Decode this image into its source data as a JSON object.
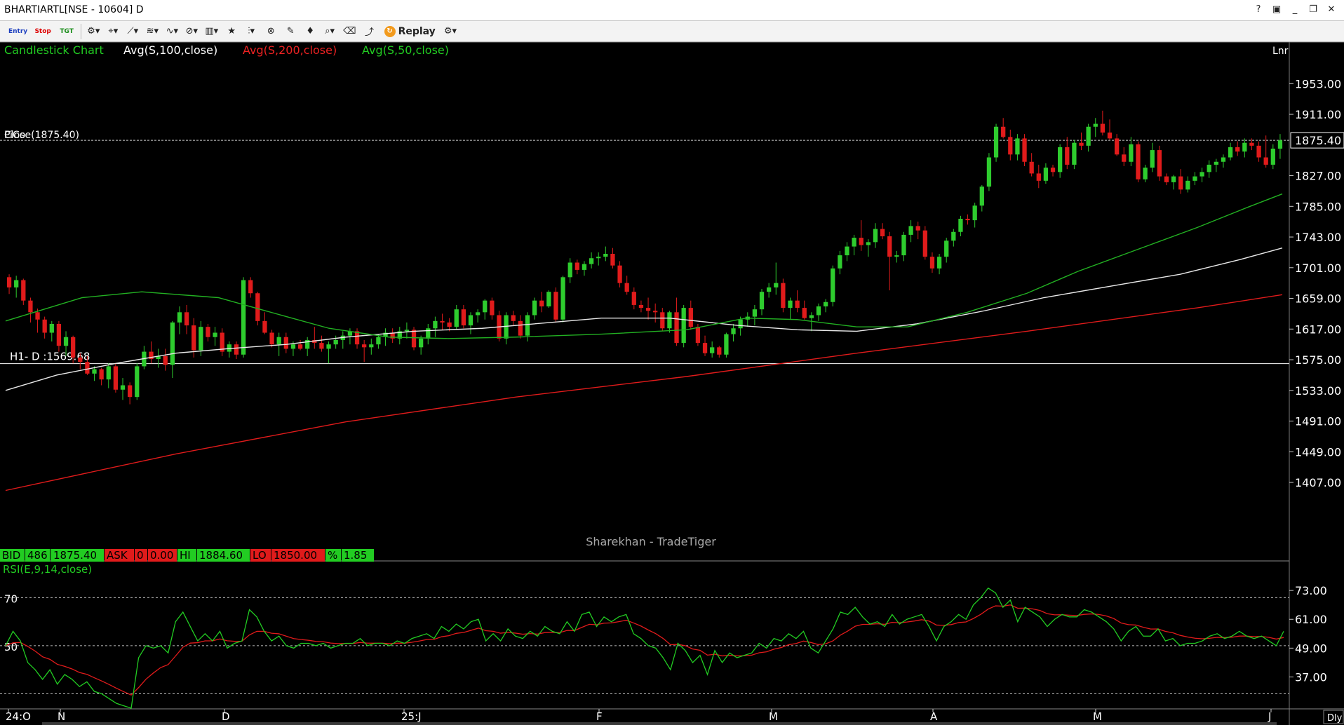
{
  "window": {
    "title": "BHARTIARTL[NSE - 10604] D",
    "buttons": [
      "help-icon",
      "monitor-icon",
      "minimize-icon",
      "restore-icon",
      "close-icon"
    ]
  },
  "toolbar": {
    "entry_label": "Entry",
    "stop_label": "Stop",
    "tgt_label": "TGT",
    "replay_label": "Replay",
    "icons": [
      "settings-wheel-icon",
      "pointer-icon",
      "line-tools-icon",
      "fib-icon",
      "wave-icon",
      "channel-icon",
      "bar-style-icon",
      "star-icon",
      "indicator-icon",
      "pattern-icon",
      "cursor-icon",
      "alert-icon",
      "zoom-icon",
      "delete-icon",
      "study-icon"
    ]
  },
  "colors": {
    "background": "#000000",
    "up": "#2ecc2e",
    "down": "#e01b1b",
    "sma100": "#e8e8e8",
    "sma200": "#e01b1b",
    "sma50": "#22b022",
    "rsi": "#22cc22",
    "rsi_signal": "#e01b1b",
    "axis_text": "#ffffff"
  },
  "legend": {
    "chart_type": "Candlestick Chart",
    "sma100": "Avg(S,100,close)",
    "sma200": "Avg(S,200,close)",
    "sma50": "Avg(S,50,close)",
    "corner": "Lnr"
  },
  "price_axis": {
    "labels": [
      "1953.00",
      "1911.00",
      "1827.00",
      "1785.00",
      "1743.00",
      "1701.00",
      "1659.00",
      "1617.00",
      "1575.00",
      "1533.00",
      "1491.00",
      "1449.00",
      "1407.00"
    ],
    "current_price_label": "1875.40"
  },
  "annotations": {
    "close_line_text": "Close(1875.40)",
    "overlap_text": "PiCo",
    "hline_text": "H1- D :1569.68",
    "watermark": "Sharekhan - TradeTiger"
  },
  "quote_bar": {
    "bid_label": "BID",
    "bid_qty": "486",
    "bid_price": "1875.40",
    "ask_label": "ASK",
    "ask_qty": "0",
    "ask_price": "0.00",
    "hi_label": "HI",
    "hi_value": "1884.60",
    "lo_label": "LO",
    "lo_value": "1850.00",
    "pct_label": "%",
    "pct_value": "1.85"
  },
  "rsi_panel": {
    "label": "RSI(E,9,14,close)",
    "left_levels": [
      "70",
      "50"
    ],
    "axis_labels": [
      "73.00",
      "61.00",
      "49.00",
      "37.00"
    ]
  },
  "time_axis": {
    "labels": [
      "24:O",
      "N",
      "D",
      "25:J",
      "F",
      "M",
      "A",
      "M",
      "J"
    ],
    "corner": "Dly"
  },
  "chart_data": {
    "type": "candlestick",
    "ylim": [
      1380,
      1975
    ],
    "current_close": 1875.4,
    "horizontal_line": 1569.68,
    "candles": [
      [
        1688,
        1692,
        1665,
        1674
      ],
      [
        1674,
        1690,
        1660,
        1684
      ],
      [
        1684,
        1686,
        1650,
        1656
      ],
      [
        1656,
        1660,
        1626,
        1640
      ],
      [
        1640,
        1645,
        1612,
        1630
      ],
      [
        1630,
        1634,
        1604,
        1612
      ],
      [
        1612,
        1628,
        1600,
        1624
      ],
      [
        1624,
        1628,
        1586,
        1594
      ],
      [
        1594,
        1614,
        1580,
        1606
      ],
      [
        1606,
        1608,
        1570,
        1578
      ],
      [
        1578,
        1584,
        1562,
        1572
      ],
      [
        1572,
        1580,
        1554,
        1556
      ],
      [
        1556,
        1566,
        1546,
        1562
      ],
      [
        1562,
        1564,
        1540,
        1548
      ],
      [
        1548,
        1570,
        1536,
        1566
      ],
      [
        1566,
        1570,
        1530,
        1534
      ],
      [
        1534,
        1550,
        1520,
        1540
      ],
      [
        1540,
        1544,
        1514,
        1524
      ],
      [
        1524,
        1570,
        1520,
        1566
      ],
      [
        1566,
        1594,
        1562,
        1586
      ],
      [
        1586,
        1600,
        1570,
        1576
      ],
      [
        1576,
        1590,
        1564,
        1580
      ],
      [
        1580,
        1590,
        1560,
        1568
      ],
      [
        1568,
        1628,
        1550,
        1626
      ],
      [
        1626,
        1648,
        1610,
        1640
      ],
      [
        1640,
        1650,
        1610,
        1622
      ],
      [
        1622,
        1632,
        1578,
        1588
      ],
      [
        1588,
        1628,
        1580,
        1620
      ],
      [
        1620,
        1624,
        1600,
        1606
      ],
      [
        1606,
        1620,
        1594,
        1612
      ],
      [
        1612,
        1618,
        1580,
        1586
      ],
      [
        1586,
        1600,
        1578,
        1596
      ],
      [
        1596,
        1600,
        1576,
        1582
      ],
      [
        1582,
        1688,
        1578,
        1684
      ],
      [
        1684,
        1688,
        1660,
        1666
      ],
      [
        1666,
        1668,
        1622,
        1628
      ],
      [
        1628,
        1640,
        1610,
        1612
      ],
      [
        1612,
        1616,
        1592,
        1596
      ],
      [
        1596,
        1612,
        1580,
        1606
      ],
      [
        1606,
        1612,
        1584,
        1590
      ],
      [
        1590,
        1600,
        1580,
        1596
      ],
      [
        1596,
        1602,
        1588,
        1590
      ],
      [
        1590,
        1606,
        1580,
        1602
      ],
      [
        1602,
        1620,
        1590,
        1598
      ],
      [
        1598,
        1608,
        1586,
        1590
      ],
      [
        1590,
        1600,
        1570,
        1596
      ],
      [
        1596,
        1608,
        1590,
        1602
      ],
      [
        1602,
        1614,
        1590,
        1608
      ],
      [
        1608,
        1618,
        1596,
        1614
      ],
      [
        1614,
        1618,
        1590,
        1596
      ],
      [
        1596,
        1602,
        1572,
        1592
      ],
      [
        1592,
        1604,
        1582,
        1596
      ],
      [
        1596,
        1610,
        1590,
        1606
      ],
      [
        1606,
        1618,
        1594,
        1612
      ],
      [
        1612,
        1618,
        1598,
        1604
      ],
      [
        1604,
        1620,
        1596,
        1614
      ],
      [
        1614,
        1626,
        1604,
        1616
      ],
      [
        1616,
        1620,
        1588,
        1592
      ],
      [
        1592,
        1608,
        1582,
        1604
      ],
      [
        1604,
        1624,
        1596,
        1618
      ],
      [
        1618,
        1634,
        1606,
        1628
      ],
      [
        1628,
        1638,
        1616,
        1626
      ],
      [
        1626,
        1632,
        1614,
        1620
      ],
      [
        1620,
        1650,
        1616,
        1644
      ],
      [
        1644,
        1650,
        1618,
        1622
      ],
      [
        1622,
        1640,
        1610,
        1636
      ],
      [
        1636,
        1644,
        1626,
        1640
      ],
      [
        1640,
        1658,
        1630,
        1656
      ],
      [
        1656,
        1660,
        1630,
        1636
      ],
      [
        1636,
        1642,
        1600,
        1604
      ],
      [
        1604,
        1640,
        1596,
        1636
      ],
      [
        1636,
        1642,
        1622,
        1628
      ],
      [
        1628,
        1636,
        1604,
        1608
      ],
      [
        1608,
        1640,
        1600,
        1636
      ],
      [
        1636,
        1660,
        1630,
        1656
      ],
      [
        1656,
        1668,
        1640,
        1648
      ],
      [
        1648,
        1670,
        1646,
        1668
      ],
      [
        1668,
        1674,
        1626,
        1630
      ],
      [
        1630,
        1690,
        1626,
        1688
      ],
      [
        1688,
        1714,
        1680,
        1708
      ],
      [
        1708,
        1712,
        1692,
        1698
      ],
      [
        1698,
        1710,
        1690,
        1706
      ],
      [
        1706,
        1722,
        1700,
        1714
      ],
      [
        1714,
        1722,
        1704,
        1716
      ],
      [
        1716,
        1730,
        1710,
        1720
      ],
      [
        1720,
        1728,
        1700,
        1704
      ],
      [
        1704,
        1710,
        1674,
        1680
      ],
      [
        1680,
        1690,
        1664,
        1668
      ],
      [
        1668,
        1674,
        1644,
        1650
      ],
      [
        1650,
        1656,
        1640,
        1646
      ],
      [
        1646,
        1660,
        1630,
        1642
      ],
      [
        1642,
        1652,
        1626,
        1640
      ],
      [
        1640,
        1646,
        1614,
        1618
      ],
      [
        1618,
        1642,
        1612,
        1640
      ],
      [
        1640,
        1660,
        1594,
        1598
      ],
      [
        1598,
        1650,
        1592,
        1646
      ],
      [
        1646,
        1656,
        1616,
        1620
      ],
      [
        1620,
        1624,
        1594,
        1598
      ],
      [
        1598,
        1608,
        1580,
        1584
      ],
      [
        1584,
        1600,
        1578,
        1592
      ],
      [
        1592,
        1594,
        1578,
        1582
      ],
      [
        1582,
        1612,
        1578,
        1610
      ],
      [
        1610,
        1624,
        1600,
        1618
      ],
      [
        1618,
        1634,
        1608,
        1630
      ],
      [
        1630,
        1640,
        1620,
        1634
      ],
      [
        1634,
        1650,
        1622,
        1644
      ],
      [
        1644,
        1672,
        1636,
        1668
      ],
      [
        1668,
        1680,
        1660,
        1674
      ],
      [
        1674,
        1708,
        1664,
        1680
      ],
      [
        1680,
        1686,
        1640,
        1646
      ],
      [
        1646,
        1660,
        1630,
        1656
      ],
      [
        1656,
        1670,
        1640,
        1646
      ],
      [
        1646,
        1656,
        1630,
        1632
      ],
      [
        1632,
        1640,
        1614,
        1636
      ],
      [
        1636,
        1652,
        1628,
        1648
      ],
      [
        1648,
        1658,
        1640,
        1654
      ],
      [
        1654,
        1704,
        1648,
        1700
      ],
      [
        1700,
        1724,
        1692,
        1718
      ],
      [
        1718,
        1736,
        1710,
        1730
      ],
      [
        1730,
        1746,
        1718,
        1742
      ],
      [
        1742,
        1766,
        1724,
        1732
      ],
      [
        1732,
        1740,
        1716,
        1736
      ],
      [
        1736,
        1762,
        1728,
        1754
      ],
      [
        1754,
        1762,
        1740,
        1744
      ],
      [
        1744,
        1750,
        1670,
        1716
      ],
      [
        1716,
        1724,
        1708,
        1718
      ],
      [
        1718,
        1750,
        1710,
        1746
      ],
      [
        1746,
        1766,
        1736,
        1758
      ],
      [
        1758,
        1764,
        1740,
        1752
      ],
      [
        1752,
        1758,
        1712,
        1716
      ],
      [
        1716,
        1722,
        1694,
        1700
      ],
      [
        1700,
        1720,
        1692,
        1716
      ],
      [
        1716,
        1742,
        1708,
        1738
      ],
      [
        1738,
        1754,
        1730,
        1750
      ],
      [
        1750,
        1772,
        1744,
        1768
      ],
      [
        1768,
        1774,
        1760,
        1766
      ],
      [
        1766,
        1790,
        1756,
        1786
      ],
      [
        1786,
        1814,
        1778,
        1812
      ],
      [
        1812,
        1858,
        1806,
        1852
      ],
      [
        1852,
        1898,
        1846,
        1894
      ],
      [
        1894,
        1906,
        1878,
        1880
      ],
      [
        1880,
        1890,
        1848,
        1856
      ],
      [
        1856,
        1884,
        1848,
        1878
      ],
      [
        1878,
        1884,
        1840,
        1846
      ],
      [
        1846,
        1858,
        1826,
        1830
      ],
      [
        1830,
        1842,
        1810,
        1820
      ],
      [
        1820,
        1844,
        1816,
        1838
      ],
      [
        1838,
        1842,
        1826,
        1832
      ],
      [
        1832,
        1870,
        1824,
        1866
      ],
      [
        1866,
        1880,
        1836,
        1842
      ],
      [
        1842,
        1876,
        1836,
        1872
      ],
      [
        1872,
        1886,
        1862,
        1868
      ],
      [
        1868,
        1898,
        1860,
        1894
      ],
      [
        1894,
        1906,
        1880,
        1898
      ],
      [
        1898,
        1916,
        1882,
        1886
      ],
      [
        1886,
        1904,
        1876,
        1878
      ],
      [
        1878,
        1884,
        1854,
        1856
      ],
      [
        1856,
        1866,
        1840,
        1846
      ],
      [
        1846,
        1880,
        1840,
        1870
      ],
      [
        1870,
        1874,
        1818,
        1822
      ],
      [
        1822,
        1842,
        1818,
        1838
      ],
      [
        1838,
        1872,
        1832,
        1862
      ],
      [
        1862,
        1868,
        1820,
        1826
      ],
      [
        1826,
        1830,
        1814,
        1818
      ],
      [
        1818,
        1828,
        1808,
        1826
      ],
      [
        1826,
        1836,
        1802,
        1808
      ],
      [
        1808,
        1826,
        1804,
        1820
      ],
      [
        1820,
        1832,
        1814,
        1826
      ],
      [
        1826,
        1838,
        1818,
        1832
      ],
      [
        1832,
        1848,
        1824,
        1842
      ],
      [
        1842,
        1850,
        1832,
        1846
      ],
      [
        1846,
        1856,
        1838,
        1852
      ],
      [
        1852,
        1872,
        1848,
        1866
      ],
      [
        1866,
        1874,
        1854,
        1860
      ],
      [
        1860,
        1878,
        1852,
        1872
      ],
      [
        1872,
        1878,
        1862,
        1868
      ],
      [
        1868,
        1874,
        1846,
        1852
      ],
      [
        1852,
        1882,
        1838,
        1842
      ],
      [
        1842,
        1870,
        1836,
        1864
      ],
      [
        1864,
        1884,
        1850,
        1875.4
      ]
    ],
    "sma50": [
      [
        0,
        1628
      ],
      [
        90,
        1660
      ],
      [
        160,
        1668
      ],
      [
        250,
        1660
      ],
      [
        330,
        1634
      ],
      [
        380,
        1618
      ],
      [
        450,
        1606
      ],
      [
        520,
        1604
      ],
      [
        600,
        1606
      ],
      [
        700,
        1610
      ],
      [
        800,
        1616
      ],
      [
        870,
        1632
      ],
      [
        930,
        1630
      ],
      [
        1000,
        1620
      ],
      [
        1060,
        1620
      ],
      [
        1130,
        1640
      ],
      [
        1200,
        1666
      ],
      [
        1260,
        1696
      ],
      [
        1330,
        1726
      ],
      [
        1400,
        1756
      ],
      [
        1460,
        1784
      ],
      [
        1500,
        1802
      ]
    ],
    "sma100": [
      [
        0,
        1533
      ],
      [
        60,
        1554
      ],
      [
        130,
        1570
      ],
      [
        200,
        1584
      ],
      [
        260,
        1590
      ],
      [
        330,
        1596
      ],
      [
        400,
        1606
      ],
      [
        480,
        1614
      ],
      [
        560,
        1618
      ],
      [
        640,
        1626
      ],
      [
        700,
        1632
      ],
      [
        780,
        1632
      ],
      [
        860,
        1622
      ],
      [
        930,
        1616
      ],
      [
        1000,
        1614
      ],
      [
        1070,
        1624
      ],
      [
        1150,
        1642
      ],
      [
        1220,
        1660
      ],
      [
        1300,
        1676
      ],
      [
        1380,
        1692
      ],
      [
        1450,
        1712
      ],
      [
        1500,
        1728
      ]
    ],
    "sma200": [
      [
        0,
        1396
      ],
      [
        200,
        1446
      ],
      [
        400,
        1490
      ],
      [
        600,
        1524
      ],
      [
        800,
        1552
      ],
      [
        1000,
        1584
      ],
      [
        1200,
        1614
      ],
      [
        1400,
        1646
      ],
      [
        1500,
        1664
      ]
    ],
    "rsi": [
      50,
      56,
      52,
      43,
      40,
      36,
      40,
      34,
      38,
      36,
      33,
      35,
      31,
      30,
      28,
      26,
      25,
      24,
      45,
      50,
      49,
      50,
      47,
      60,
      64,
      58,
      52,
      55,
      52,
      56,
      49,
      51,
      52,
      65,
      62,
      56,
      52,
      54,
      50,
      49,
      51,
      51,
      50,
      51,
      49,
      50,
      51,
      51,
      53,
      50,
      51,
      51,
      50,
      52,
      51,
      53,
      54,
      55,
      53,
      58,
      56,
      59,
      57,
      60,
      61,
      52,
      55,
      52,
      57,
      54,
      53,
      56,
      54,
      58,
      56,
      55,
      60,
      56,
      63,
      64,
      58,
      62,
      60,
      62,
      63,
      55,
      53,
      50,
      49,
      45,
      40,
      51,
      48,
      43,
      46,
      38,
      48,
      43,
      47,
      45,
      46,
      47,
      51,
      49,
      53,
      52,
      55,
      53,
      56,
      49,
      47,
      52,
      57,
      64,
      63,
      66,
      62,
      59,
      60,
      58,
      63,
      59,
      61,
      62,
      63,
      58,
      52,
      58,
      60,
      63,
      61,
      67,
      70,
      74,
      72,
      66,
      69,
      60,
      66,
      64,
      62,
      58,
      61,
      63,
      62,
      62,
      65,
      64,
      62,
      60,
      57,
      52,
      56,
      58,
      54,
      54,
      57,
      52,
      53,
      50,
      51,
      51,
      52,
      54,
      55,
      53,
      54,
      56,
      54,
      53,
      54,
      52,
      50,
      56
    ]
  }
}
